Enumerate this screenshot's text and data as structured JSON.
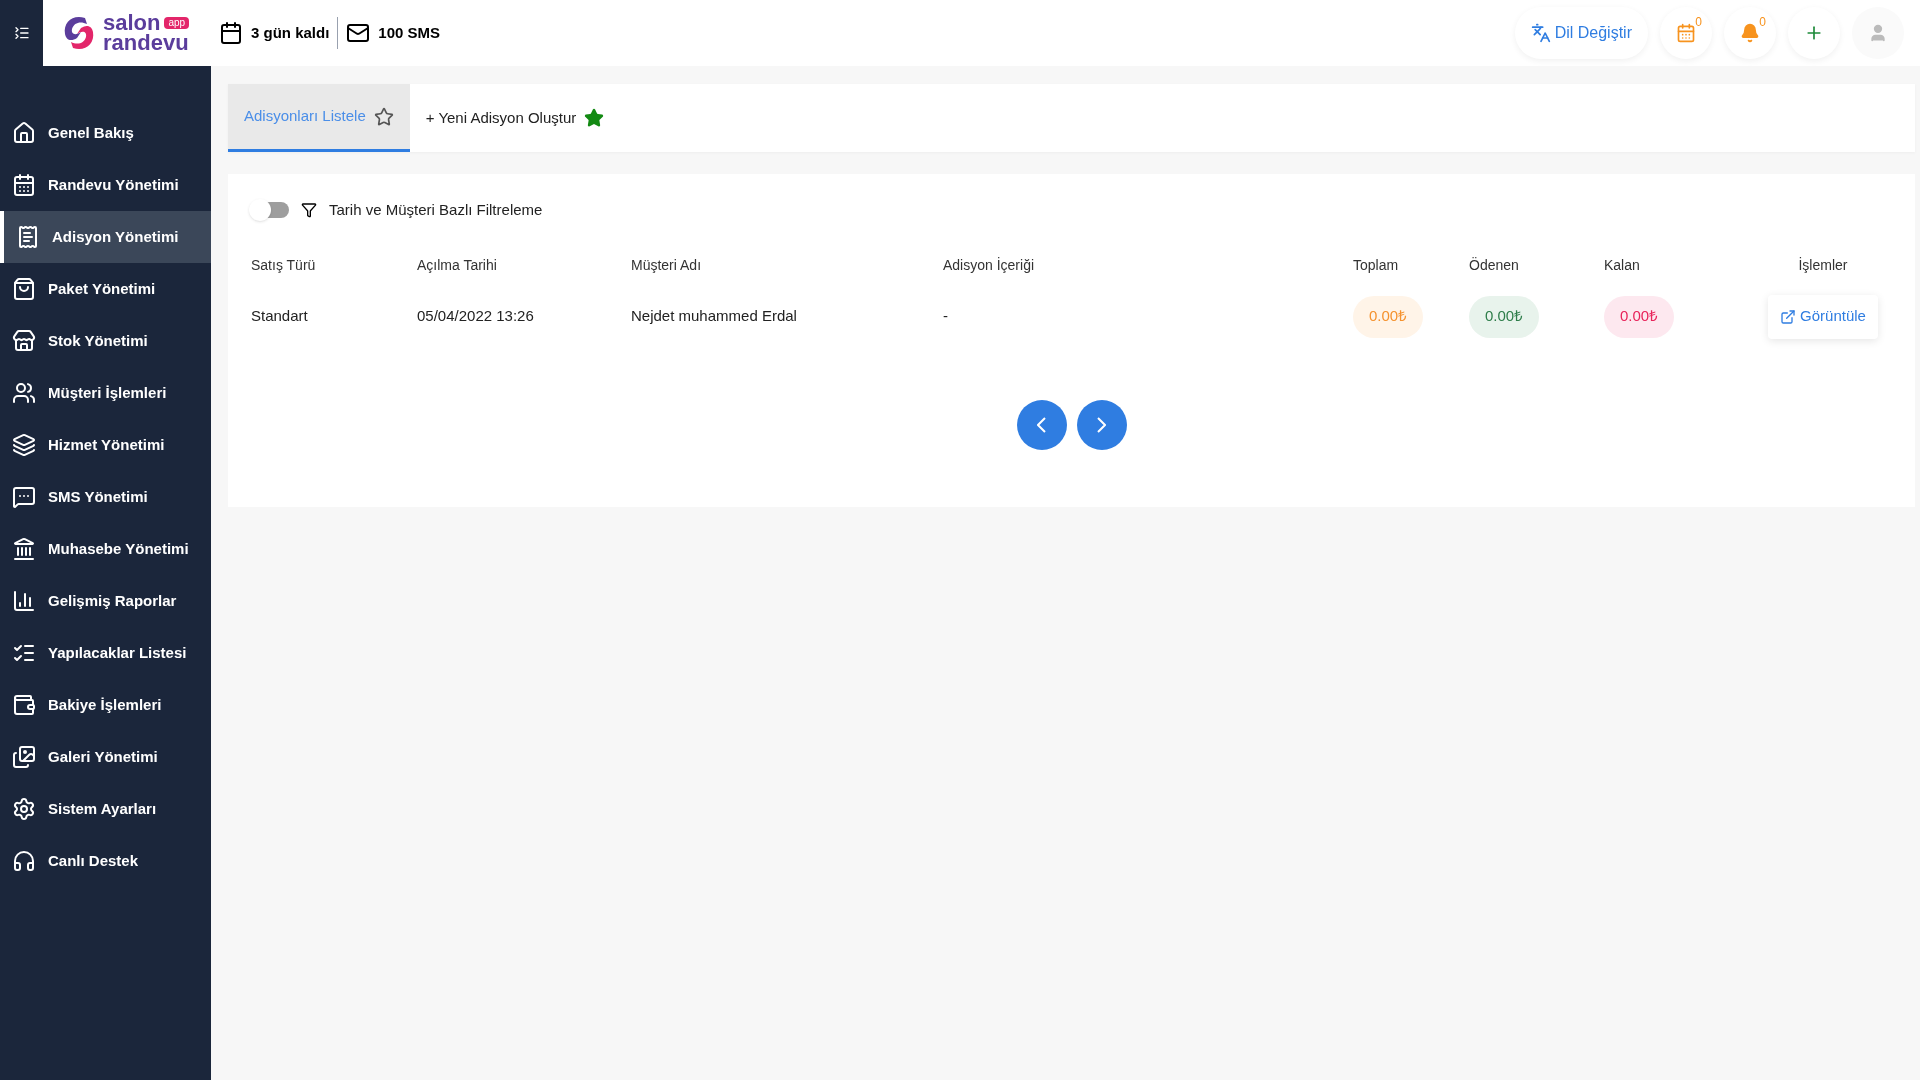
{
  "header": {
    "logo": {
      "word1": "salon",
      "badge": "app",
      "word2": "randevu"
    },
    "days_left": "3 gün kaldı",
    "sms": "100 SMS",
    "language_button": "Dil Değiştir",
    "calendar_count": "0",
    "notification_count": "0"
  },
  "sidebar": {
    "items": [
      {
        "label": "Genel Bakış",
        "selected": false
      },
      {
        "label": "Randevu Yönetimi",
        "selected": false
      },
      {
        "label": "Adisyon Yönetimi",
        "selected": true
      },
      {
        "label": "Paket Yönetimi",
        "selected": false
      },
      {
        "label": "Stok Yönetimi",
        "selected": false
      },
      {
        "label": "Müşteri İşlemleri",
        "selected": false
      },
      {
        "label": "Hizmet Yönetimi",
        "selected": false
      },
      {
        "label": "SMS Yönetimi",
        "selected": false
      },
      {
        "label": "Muhasebe Yönetimi",
        "selected": false
      },
      {
        "label": "Gelişmiş Raporlar",
        "selected": false
      },
      {
        "label": "Yapılacaklar Listesi",
        "selected": false
      },
      {
        "label": "Bakiye İşlemleri",
        "selected": false
      },
      {
        "label": "Galeri Yönetimi",
        "selected": false
      },
      {
        "label": "Sistem Ayarları",
        "selected": false
      },
      {
        "label": "Canlı Destek",
        "selected": false
      }
    ]
  },
  "tabs": [
    {
      "label": "Adisyonları Listele",
      "selected": true
    },
    {
      "label": "+ Yeni Adisyon Oluştur",
      "selected": false
    }
  ],
  "filter": {
    "on": false,
    "label": "Tarih ve Müşteri Bazlı Filtreleme"
  },
  "table": {
    "columns": [
      "Satış Türü",
      "Açılma Tarihi",
      "Müşteri Adı",
      "Adisyon İçeriği",
      "Toplam",
      "Ödenen",
      "Kalan",
      "İşlemler"
    ],
    "rows": [
      {
        "sale_type": "Standart",
        "opened": "05/04/2022 13:26",
        "customer": "Nejdet muhammed Erdal",
        "content": "-",
        "total": "0.00₺",
        "paid": "0.00₺",
        "remaining": "0.00₺",
        "action": "Görüntüle"
      }
    ]
  }
}
